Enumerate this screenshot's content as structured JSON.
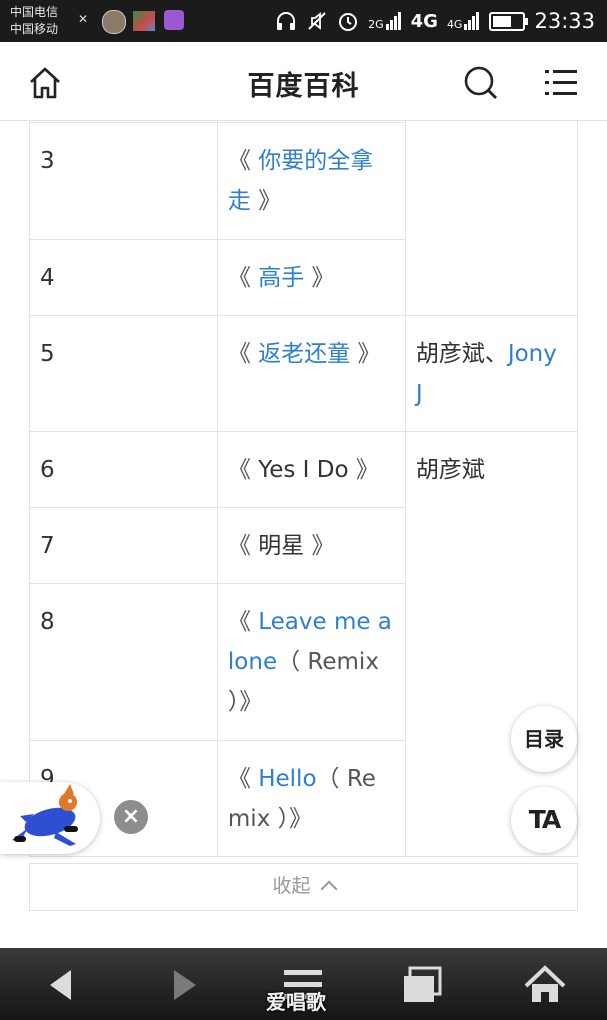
{
  "status_bar": {
    "carrier_1": "中国电信",
    "carrier_2": "中国移动",
    "signal_2g": "2G",
    "signal_4g": "4G",
    "signal_4g_2": "4G",
    "time": "23:33"
  },
  "header": {
    "title": "百度百科",
    "icons": [
      "home-icon",
      "search-icon",
      "menu-icon"
    ]
  },
  "table": {
    "rows": [
      {
        "num": "3",
        "bracket_open": "《 ",
        "song": "你要的全拿走",
        "song_linked": true,
        "suffix": "",
        "bracket_close": " 》",
        "artist": "",
        "artist_link": ""
      },
      {
        "num": "4",
        "bracket_open": "《 ",
        "song": "高手",
        "song_linked": true,
        "suffix": "",
        "bracket_close": " 》",
        "artist": "",
        "artist_link": ""
      },
      {
        "num": "5",
        "bracket_open": "《 ",
        "song": "返老还童",
        "song_linked": true,
        "suffix": "",
        "bracket_close": " 》",
        "artist": "胡彦斌、",
        "artist_link": "Jony J"
      },
      {
        "num": "6",
        "bracket_open": "《 ",
        "song": "Yes I Do",
        "song_linked": false,
        "suffix": "",
        "bracket_close": " 》",
        "artist": "胡彦斌",
        "artist_link": ""
      },
      {
        "num": "7",
        "bracket_open": "《 ",
        "song": "明星",
        "song_linked": false,
        "suffix": "",
        "bracket_close": " 》",
        "artist": "",
        "artist_link": ""
      },
      {
        "num": "8",
        "bracket_open": "《 ",
        "song": "Leave me alone",
        "song_linked": true,
        "suffix": "（ Remix ）",
        "bracket_close": "》",
        "artist": "",
        "artist_link": ""
      },
      {
        "num": "9",
        "bracket_open": "《 ",
        "song": "Hello",
        "song_linked": true,
        "suffix": "（ Remix ）",
        "bracket_close": "》",
        "artist": "",
        "artist_link": ""
      }
    ],
    "collapse_label": "收起"
  },
  "floating": {
    "toc_label": "目录",
    "ta_label": "TA",
    "mascot_close": "×"
  },
  "bottom_nav": {
    "icons": [
      "back-icon",
      "forward-icon",
      "menu-icon",
      "tabs-icon",
      "home-icon"
    ],
    "watermark": "爱唱歌"
  },
  "colors": {
    "link": "#2f7fd0",
    "text": "#333333",
    "border": "#e3e3e3",
    "status_bar": "#1b1b1b"
  }
}
